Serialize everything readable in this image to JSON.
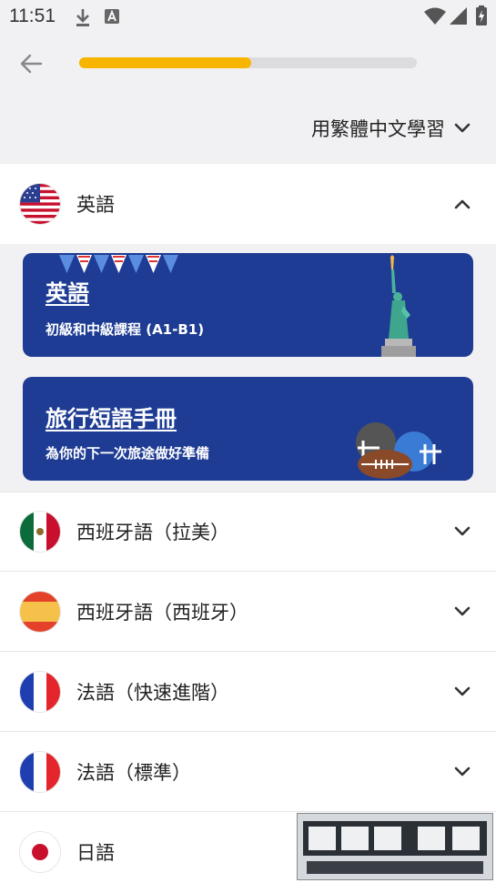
{
  "status_bar": {
    "time": "11:51"
  },
  "header": {
    "progress": 0.51
  },
  "language_selector": {
    "label": "用繁體中文學習"
  },
  "languages": [
    {
      "label": "英語",
      "expanded": true,
      "courses": [
        {
          "title": "英語",
          "subtitle": "初級和中級課程 (A1-B1)"
        },
        {
          "title": "旅行短語手冊",
          "subtitle": "為你的下一次旅途做好準備"
        }
      ]
    },
    {
      "label": "西班牙語（拉美）"
    },
    {
      "label": "西班牙語（西班牙）"
    },
    {
      "label": "法語（快速進階）"
    },
    {
      "label": "法語（標準）"
    },
    {
      "label": "日語"
    }
  ],
  "colors": {
    "accent": "#f7b500",
    "card_bg": "#1e3c93"
  }
}
